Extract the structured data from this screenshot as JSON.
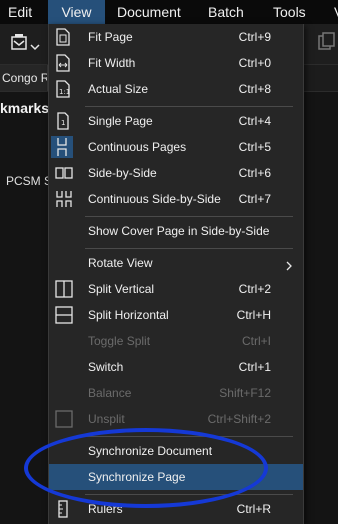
{
  "menubar": {
    "items": [
      {
        "label": "Edit"
      },
      {
        "label": "View"
      },
      {
        "label": "Document"
      },
      {
        "label": "Batch"
      },
      {
        "label": "Tools"
      },
      {
        "label": "V"
      }
    ],
    "active": "View"
  },
  "toolbar": {
    "icons": [
      "stamp-icon",
      "chevron-down-icon",
      "copy-icon"
    ]
  },
  "document_tab": {
    "label": "Congo Re"
  },
  "bookmarks_panel": {
    "header": "kmarks",
    "item": "PCSM S"
  },
  "view_menu": {
    "items": [
      {
        "label": "Fit Page",
        "shortcut": "Ctrl+9",
        "icon": "fit-page-icon",
        "enabled": true
      },
      {
        "label": "Fit Width",
        "shortcut": "Ctrl+0",
        "icon": "fit-width-icon",
        "enabled": true
      },
      {
        "label": "Actual Size",
        "shortcut": "Ctrl+8",
        "icon": "actual-size-icon",
        "enabled": true
      },
      {
        "label": "Single Page",
        "shortcut": "Ctrl+4",
        "icon": "single-page-icon",
        "enabled": true
      },
      {
        "label": "Continuous Pages",
        "shortcut": "Ctrl+5",
        "icon": "continuous-pages-icon",
        "enabled": true,
        "checked": true
      },
      {
        "label": "Side-by-Side",
        "shortcut": "Ctrl+6",
        "icon": "side-by-side-icon",
        "enabled": true
      },
      {
        "label": "Continuous Side-by-Side",
        "shortcut": "Ctrl+7",
        "icon": "continuous-side-by-side-icon",
        "enabled": true
      },
      {
        "label": "Show Cover Page in Side-by-Side",
        "shortcut": "",
        "enabled": true
      },
      {
        "label": "Rotate View",
        "shortcut": "",
        "enabled": true,
        "submenu": true
      },
      {
        "label": "Split Vertical",
        "shortcut": "Ctrl+2",
        "icon": "split-vertical-icon",
        "enabled": true
      },
      {
        "label": "Split Horizontal",
        "shortcut": "Ctrl+H",
        "icon": "split-horizontal-icon",
        "enabled": true
      },
      {
        "label": "Toggle Split",
        "shortcut": "Ctrl+I",
        "enabled": false
      },
      {
        "label": "Switch",
        "shortcut": "Ctrl+1",
        "enabled": true
      },
      {
        "label": "Balance",
        "shortcut": "Shift+F12",
        "enabled": false
      },
      {
        "label": "Unsplit",
        "shortcut": "Ctrl+Shift+2",
        "icon": "unsplit-icon",
        "enabled": false
      },
      {
        "label": "Synchronize Document",
        "shortcut": "",
        "enabled": true
      },
      {
        "label": "Synchronize Page",
        "shortcut": "",
        "enabled": true,
        "highlighted": true
      },
      {
        "label": "Rulers",
        "shortcut": "Ctrl+R",
        "icon": "rulers-icon",
        "enabled": true
      }
    ]
  },
  "colors": {
    "menu_bg": "#262626",
    "highlight": "#26507a",
    "disabled_text": "#6b6b6b",
    "annotation": "#1539d6"
  }
}
